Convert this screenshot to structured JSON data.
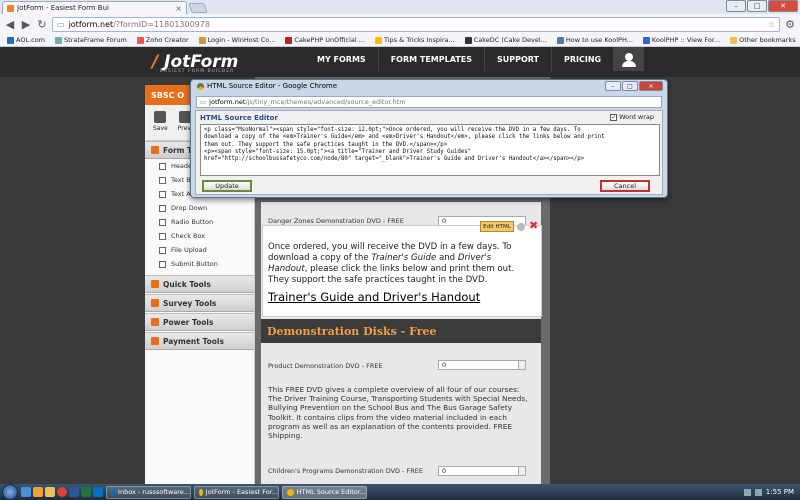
{
  "browser": {
    "tab_title": "JotForm - Easiest Form Bui",
    "url_host": "jotform.net",
    "url_path": "/?formID=11801300978",
    "window_buttons": [
      "–",
      "□",
      "✕"
    ]
  },
  "bookmarks": [
    {
      "label": "AOL.com",
      "color": "#1b6ec2"
    },
    {
      "label": "StrataFrame Forum",
      "color": "#7aa"
    },
    {
      "label": "Zoho Creator",
      "color": "#e55"
    },
    {
      "label": "Login - WinHost Co...",
      "color": "#c93"
    },
    {
      "label": "CakePHP UnOfficial ...",
      "color": "#b22"
    },
    {
      "label": "Tips & Tricks Inspira...",
      "color": "#fb0"
    },
    {
      "label": "CakeDC (Cake Devel...",
      "color": "#333"
    },
    {
      "label": "How to use KoolPH...",
      "color": "#57a"
    },
    {
      "label": "KoolPHP :: View For...",
      "color": "#36c"
    }
  ],
  "bookmarks_other": "Other bookmarks",
  "jotform": {
    "logo": "JotForm",
    "logo_slash": "/",
    "logo_sub": "EASIEST FORM BUILDER",
    "nav": [
      "MY FORMS",
      "FORM TEMPLATES",
      "SUPPORT",
      "PRICING"
    ],
    "form_name": "SBSC O",
    "toolbar": {
      "save": "Save",
      "preview": "Previ"
    },
    "form_tools_header": "Form T",
    "form_tools": [
      "Heade",
      "Text B",
      "Text Ar",
      "Drop Down",
      "Radio Button",
      "Check Box",
      "File Upload",
      "Submit Button"
    ],
    "sections": [
      "Quick Tools",
      "Survey Tools",
      "Power Tools",
      "Payment Tools"
    ]
  },
  "form": {
    "danger_label": "Danger Zones Demonstration DVD - FREE",
    "danger_value": "0",
    "edit_html": "Edit HTML",
    "popup_text": "Once ordered, you will receive the DVD in a few days. To download a copy of the ",
    "popup_em1": "Trainer's Guide",
    "popup_and": " and ",
    "popup_em2": "Driver's Handout",
    "popup_rest": ", please click the links below and print them out. They support the safe practices taught in the DVD.",
    "popup_link": "Trainer's Guide and Driver's Handout",
    "demo_header": "Demonstration Disks - Free",
    "product_label": "Product Demonstration DVD - FREE",
    "product_value": "0",
    "description": "This FREE DVD gives a complete overview of all four of our courses: The Driver Training Course, Transporting Students with Special Needs, Bullying Prevention on the School Bus and The Bus Garage Safety Toolkit.  It contains clips from the video material included in each program as well as an explanation of the contents provided.  FREE Shipping.",
    "children_label": "Children's Programs Demonstration DVD - FREE",
    "children_value": "0"
  },
  "dialog": {
    "title": "HTML Source Editor - Google Chrome",
    "url_host": "jotform.net",
    "url_path": "/js/tiny_mce/themes/advanced/source_editor.htm",
    "editor_title": "HTML Source Editor",
    "word_wrap": "Word wrap",
    "source": "<p class=\"MsoNormal\"><span style=\"font-size: 12.0pt;\">Once ordered, you will receive the DVD in a few days. To\ndownload a copy of the <em>Trainer's Guide</em> and <em>Driver's Handout</em>, please click the links below and print\nthem out. They support the safe practices taught in the DVD.</span></p>\n<p><span style=\"font-size: 15.0pt;\"><a title=\"Trainer and Driver Study Guides\"\nhref=\"http://schoolbussafetyco.com/node/80\" target=\"_blank\">Trainer's Guide and Driver's Handout</a></span></p>",
    "update": "Update",
    "cancel": "Cancel"
  },
  "taskbar": {
    "tasks": [
      "Inbox - russsoftware...",
      "JotForm - Easiest For...",
      "HTML Source Editor..."
    ],
    "time": "1:55 PM"
  }
}
